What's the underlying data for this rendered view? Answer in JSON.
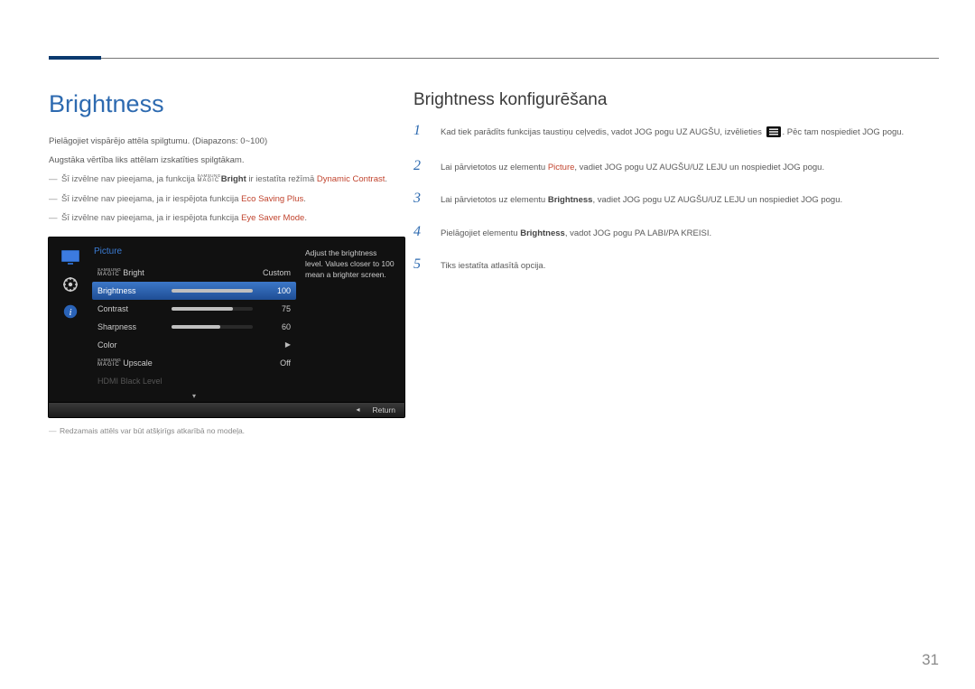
{
  "page_number": "31",
  "left": {
    "heading": "Brightness",
    "para1": "Pielāgojiet vispārējo attēla spilgtumu. (Diapazons: 0~100)",
    "para2": "Augstāka vērtība liks attēlam izskatīties spilgtākam.",
    "note1_a": "Šī izvēlne nav pieejama, ja funkcija ",
    "note1_b": "Bright",
    "note1_c": " ir iestatīta režīmā ",
    "note1_d": "Dynamic Contrast",
    "note1_e": ".",
    "note2_a": "Šī izvēlne nav pieejama, ja ir iespējota funkcija ",
    "note2_b": "Eco Saving Plus",
    "note2_c": ".",
    "note3_a": "Šī izvēlne nav pieejama, ja ir iespējota funkcija ",
    "note3_b": "Eye Saver Mode",
    "note3_c": ".",
    "caption": "Redzamais attēls var būt atšķirīgs atkarībā no modeļa."
  },
  "osd": {
    "title": "Picture",
    "help": "Adjust the brightness level. Values closer to 100 mean a brighter screen.",
    "rows": {
      "magicbright_label": "Bright",
      "magicbright_val": "Custom",
      "brightness_label": "Brightness",
      "brightness_val": "100",
      "brightness_pct": 100,
      "contrast_label": "Contrast",
      "contrast_val": "75",
      "contrast_pct": 75,
      "sharpness_label": "Sharpness",
      "sharpness_val": "60",
      "sharpness_pct": 60,
      "color_label": "Color",
      "upscale_label": "Upscale",
      "upscale_val": "Off",
      "hdmi_label": "HDMI Black Level"
    },
    "footer_return": "Return"
  },
  "right": {
    "heading": "Brightness konfigurēšana",
    "step1_a": "Kad tiek parādīts funkcijas taustiņu ceļvedis, vadot JOG pogu UZ AUGŠU, izvēlieties ",
    "step1_b": ". Pēc tam nospiediet JOG pogu.",
    "step2_a": "Lai pārvietotos uz elementu ",
    "step2_b": "Picture",
    "step2_c": ", vadiet JOG pogu UZ AUGŠU/UZ LEJU un nospiediet JOG pogu.",
    "step3_a": "Lai pārvietotos uz elementu ",
    "step3_b": "Brightness",
    "step3_c": ", vadiet JOG pogu UZ AUGŠU/UZ LEJU un nospiediet JOG pogu.",
    "step4_a": "Pielāgojiet elementu ",
    "step4_b": "Brightness",
    "step4_c": ", vadot JOG pogu PA LABI/PA KREISI.",
    "step5": "Tiks iestatīta atlasītā opcija."
  }
}
